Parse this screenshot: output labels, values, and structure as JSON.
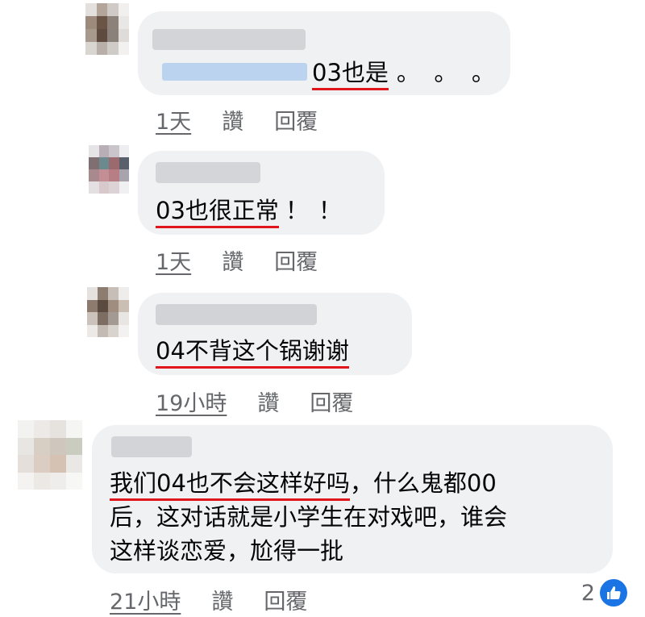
{
  "comments": [
    {
      "text": "03也是",
      "trail": "。。。",
      "time": "1天",
      "like_label": "讚",
      "reply_label": "回覆"
    },
    {
      "text": "03也很正常",
      "trail": "！！",
      "time": "1天",
      "like_label": "讚",
      "reply_label": "回覆"
    },
    {
      "text": "04不背这个锅谢谢",
      "time": "19小時",
      "like_label": "讚",
      "reply_label": "回覆"
    },
    {
      "line1_underlined": "我们04也不会这样好吗",
      "line1_rest": "，什么鬼都00",
      "line2": "后，这对话就是小学生在对戏吧，谁会",
      "line3": "这样谈恋爱，尬得一批",
      "time": "21小時",
      "like_label": "讚",
      "reply_label": "回覆",
      "reaction_count": "2",
      "reaction_icon": "like-thumb-icon"
    }
  ],
  "colors": {
    "bubble": "#eff1f3",
    "underline": "#e0161c",
    "meta": "#65676b",
    "like": "#1b74e4"
  }
}
